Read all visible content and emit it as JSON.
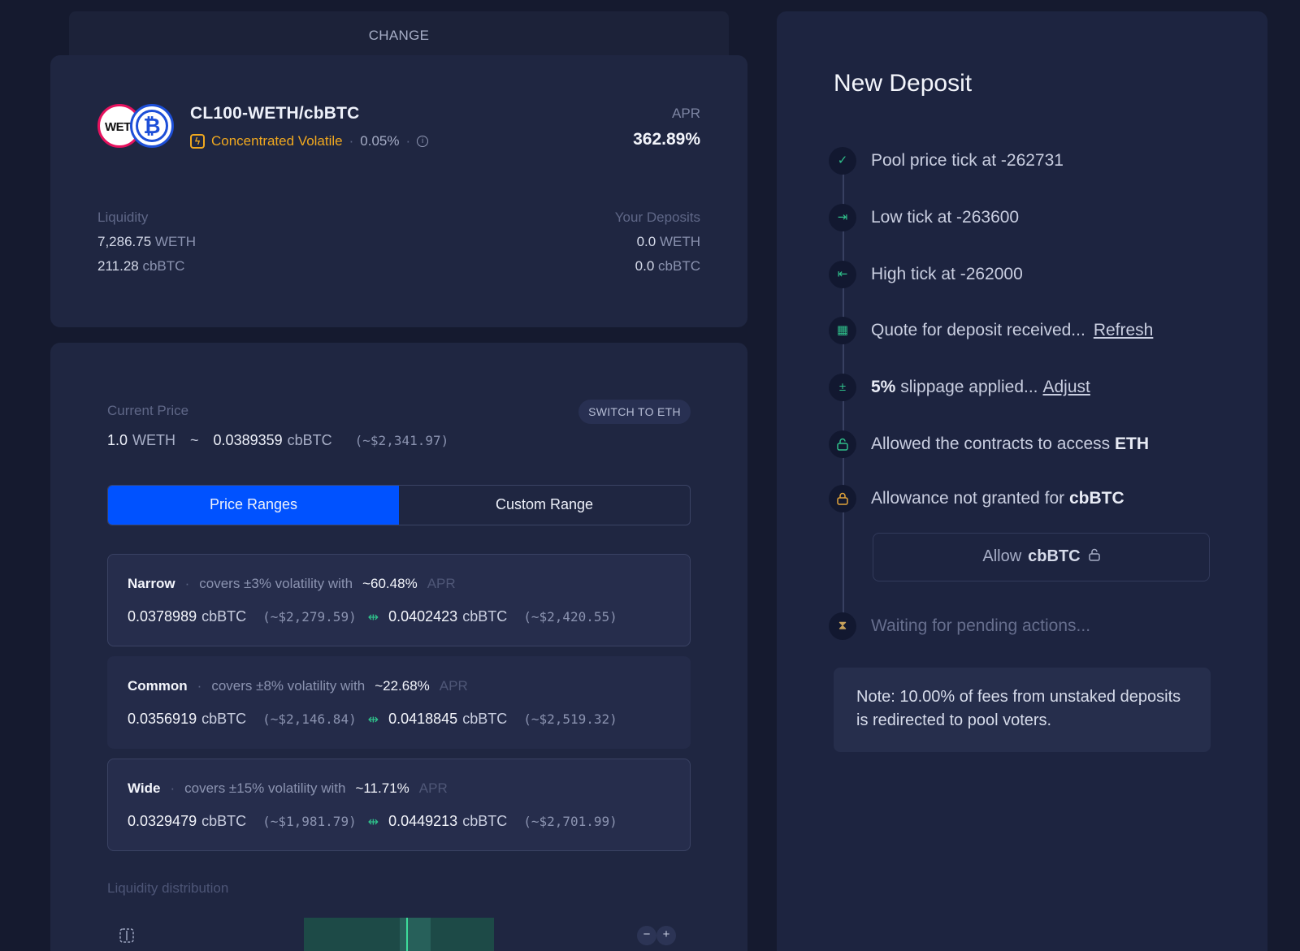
{
  "change_tab": {
    "label": "CHANGE"
  },
  "pool": {
    "icon_left": "WETH",
    "icon_right": "₿",
    "name": "CL100-WETH/cbBTC",
    "type": "Concentrated Volatile",
    "fee": "0.05%",
    "apr_label": "APR",
    "apr_value": "362.89%",
    "liquidity_label": "Liquidity",
    "liquidity": [
      {
        "value": "7,286.75",
        "unit": "WETH"
      },
      {
        "value": "211.28",
        "unit": "cbBTC"
      }
    ],
    "deposits_label": "Your Deposits",
    "deposits": [
      {
        "value": "0.0",
        "unit": "WETH"
      },
      {
        "value": "0.0",
        "unit": "cbBTC"
      }
    ]
  },
  "current_price": {
    "label": "Current Price",
    "switch_label": "SWITCH TO ETH",
    "base_value": "1.0",
    "base_unit": "WETH",
    "tilde": "~",
    "quote_value": "0.0389359",
    "quote_unit": "cbBTC",
    "usd": "(~$2,341.97)"
  },
  "range_toggle": {
    "left": "Price Ranges",
    "right": "Custom Range",
    "active": "Price Ranges"
  },
  "ranges": [
    {
      "name": "Narrow",
      "desc": "covers ±3% volatility with",
      "apr": "~60.48%",
      "apr_label": "APR",
      "low": "0.0378989",
      "low_usd": "(~$2,279.59)",
      "high": "0.0402423",
      "high_usd": "(~$2,420.55)",
      "unit": "cbBTC"
    },
    {
      "name": "Common",
      "desc": "covers ±8% volatility with",
      "apr": "~22.68%",
      "apr_label": "APR",
      "low": "0.0356919",
      "low_usd": "(~$2,146.84)",
      "high": "0.0418845",
      "high_usd": "(~$2,519.32)",
      "unit": "cbBTC"
    },
    {
      "name": "Wide",
      "desc": "covers ±15% volatility with",
      "apr": "~11.71%",
      "apr_label": "APR",
      "low": "0.0329479",
      "low_usd": "(~$1,981.79)",
      "high": "0.0449213",
      "high_usd": "(~$2,701.99)",
      "unit": "cbBTC"
    }
  ],
  "liquidity_distribution": {
    "label": "Liquidity distribution"
  },
  "deposit": {
    "title": "New Deposit",
    "steps": {
      "pool_tick": "Pool price tick at -262731",
      "low_tick": "Low tick at -263600",
      "high_tick": "High tick at -262000",
      "quote": "Quote for deposit received...",
      "quote_link": "Refresh",
      "slippage_bold": "5%",
      "slippage": "slippage applied...",
      "slippage_link": "Adjust",
      "allowed": "Allowed the contracts to access",
      "allowed_token": "ETH",
      "not_granted": "Allowance not granted for",
      "not_granted_token": "cbBTC",
      "allow_button": "Allow",
      "allow_token": "cbBTC",
      "waiting": "Waiting for pending actions..."
    },
    "note": "Note: 10.00% of fees from unstaked deposits is redirected to pool voters."
  },
  "colors": {
    "accent": "#0052ff",
    "warning": "#f0a81f",
    "success": "#2fbf8a"
  }
}
